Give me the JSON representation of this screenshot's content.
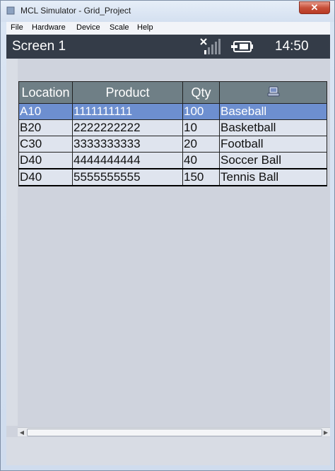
{
  "window": {
    "title": "MCL Simulator - Grid_Project",
    "close_label": "✕"
  },
  "menu": {
    "items": [
      "File",
      "Hardware",
      "Device",
      "Scale",
      "Help"
    ]
  },
  "status": {
    "screen_title": "Screen 1",
    "time": "14:50",
    "icons": [
      "signal-no-service-icon",
      "battery-charging-icon"
    ]
  },
  "grid": {
    "columns": [
      "Location",
      "Product",
      "Qty",
      ""
    ],
    "header_icon": "device-icon",
    "rows": [
      [
        "A10",
        "1111111111",
        "100",
        "Baseball"
      ],
      [
        "B20",
        "2222222222",
        "10",
        "Basketball"
      ],
      [
        "C30",
        "3333333333",
        "20",
        "Football"
      ],
      [
        "D40",
        "4444444444",
        "40",
        "Soccer Ball"
      ],
      [
        "D40",
        "5555555555",
        "150",
        "Tennis Ball"
      ]
    ],
    "selected_row": 0,
    "current_row": 4
  },
  "colors": {
    "status_bar": "#343c48",
    "header_bg": "#6f7f86",
    "selected_row": "#6d8fd0",
    "grid_bg": "#dfe4ee"
  }
}
